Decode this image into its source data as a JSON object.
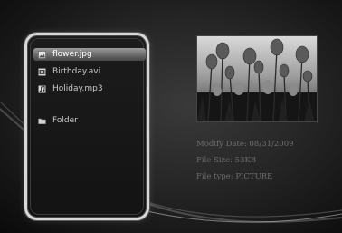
{
  "files": [
    {
      "name": "flower.jpg",
      "icon": "image-icon",
      "selected": true
    },
    {
      "name": "Birthday.avi",
      "icon": "video-icon",
      "selected": false
    },
    {
      "name": "Holiday.mp3",
      "icon": "music-icon",
      "selected": false
    },
    {
      "name": "Folder",
      "icon": "folder-icon",
      "selected": false
    }
  ],
  "info": {
    "modify_date": "Modify Date: 08/31/2009",
    "file_size": "File Size: 53KB",
    "file_type": "File type: PICTURE"
  }
}
